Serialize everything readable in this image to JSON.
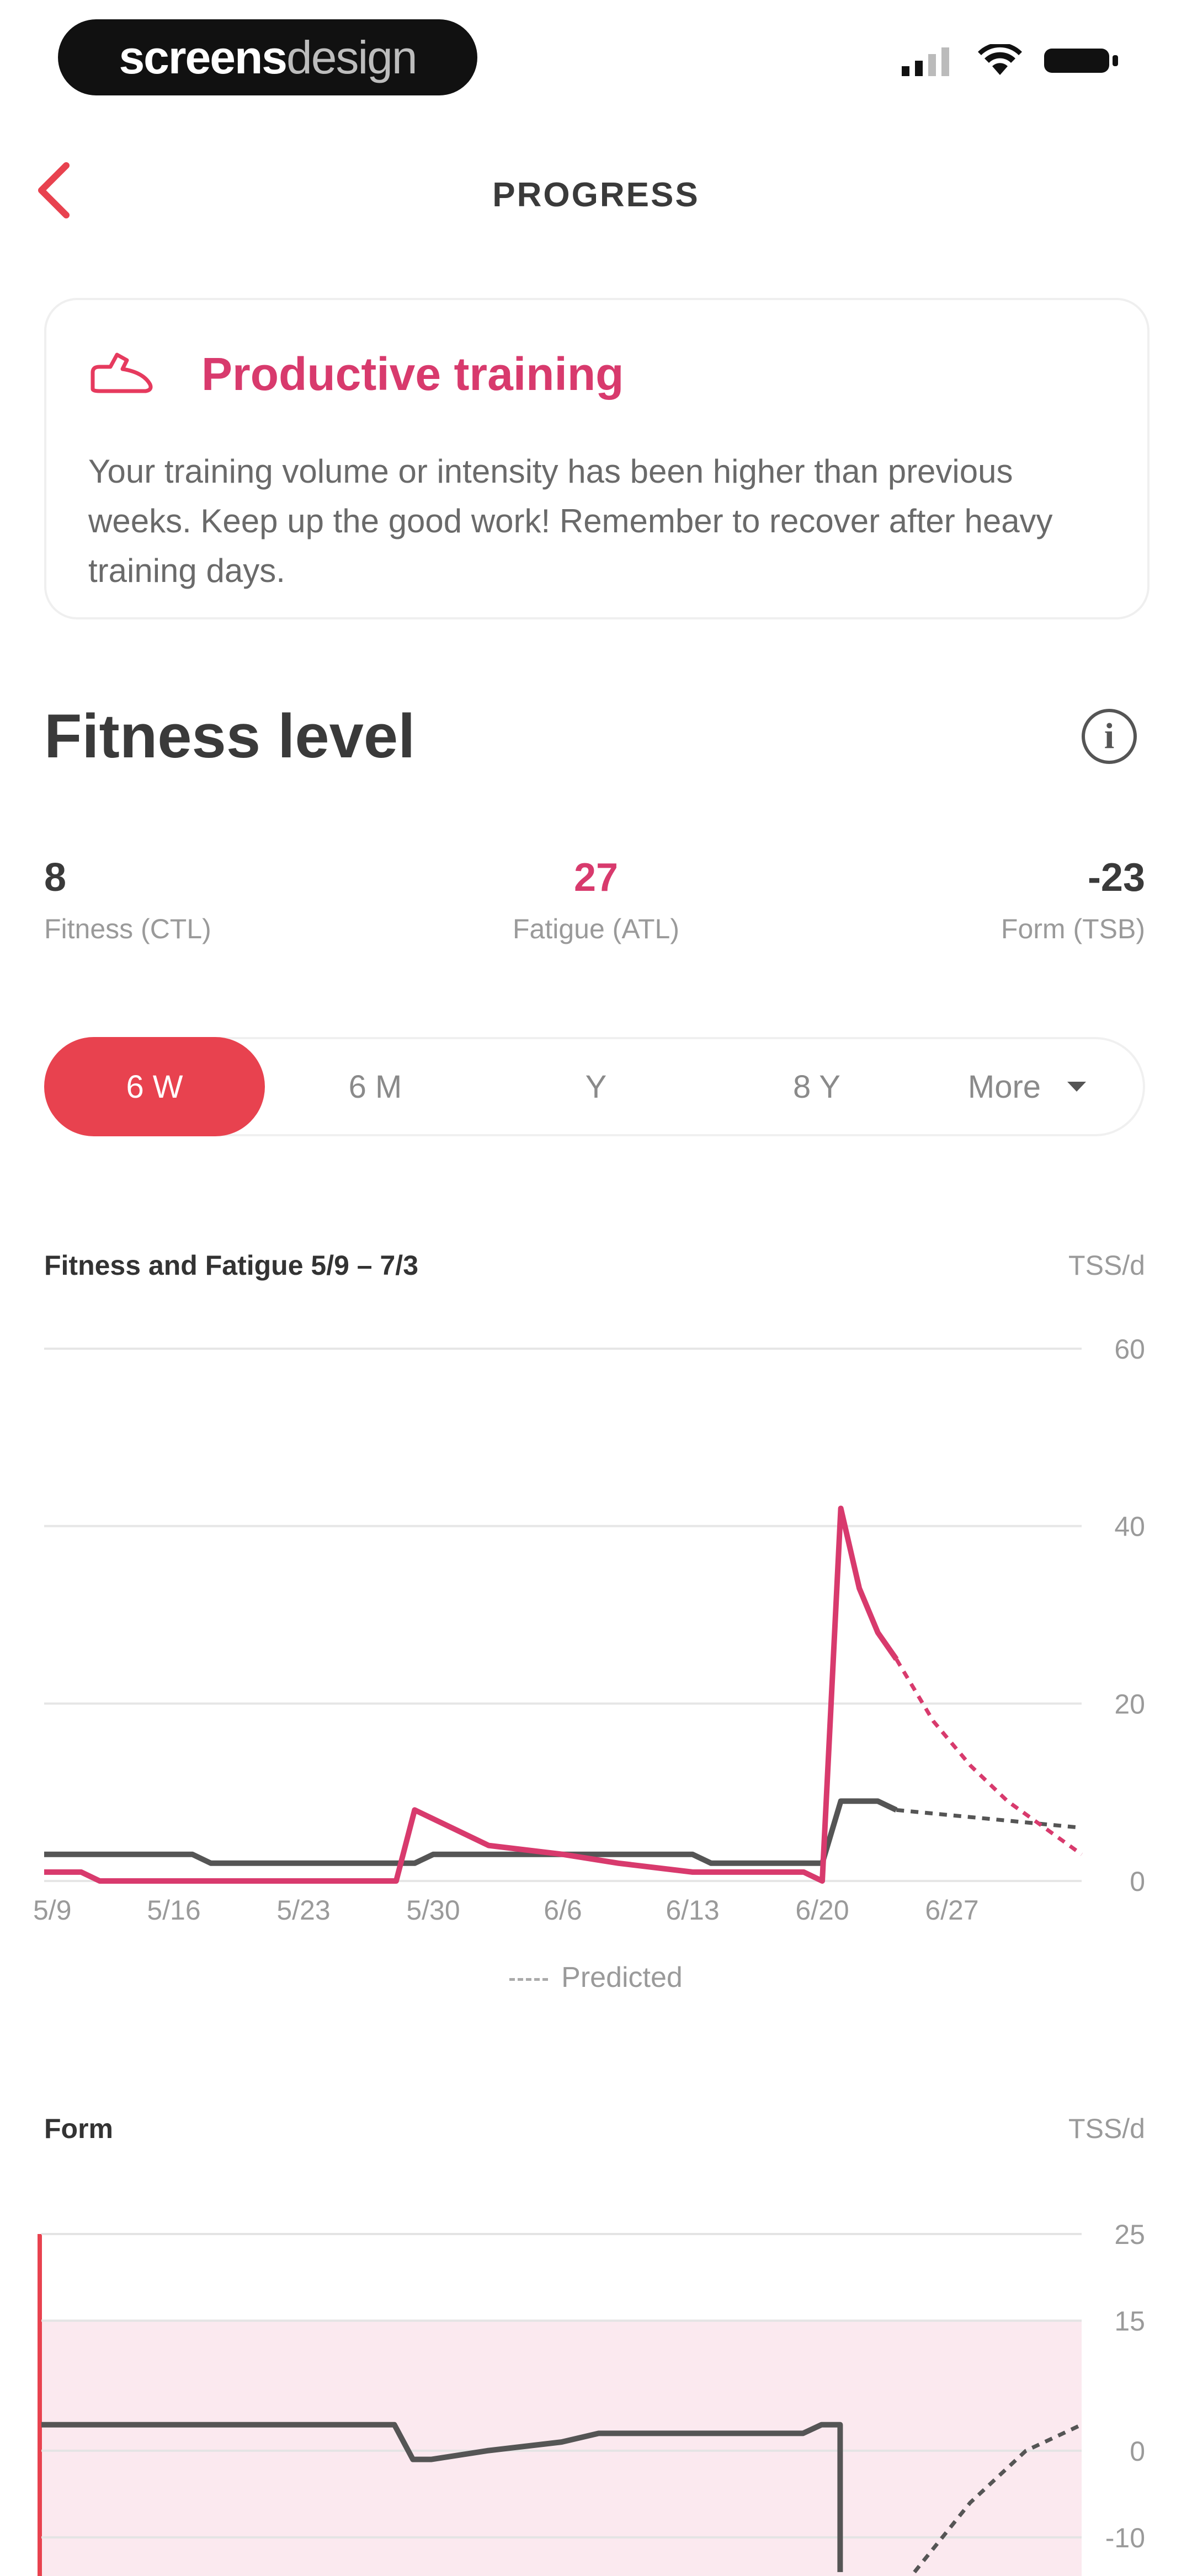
{
  "status_bar": {
    "brand_main": "screens",
    "brand_light": "design"
  },
  "header": {
    "title": "PROGRESS"
  },
  "card": {
    "title": "Productive training",
    "text": "Your training volume or intensity has been higher than previous weeks. Keep up the good work! Remember to recover after heavy training days."
  },
  "section": {
    "title": "Fitness level",
    "info_glyph": "i"
  },
  "metrics": [
    {
      "value": "8",
      "label": "Fitness (CTL)",
      "color": "#3a3a3a"
    },
    {
      "value": "27",
      "label": "Fatigue (ATL)",
      "color": "#d83a6d"
    },
    {
      "value": "-23",
      "label": "Form (TSB)",
      "color": "#3a3a3a"
    }
  ],
  "range_tabs": [
    {
      "label": "6 W",
      "active": true
    },
    {
      "label": "6 M",
      "active": false
    },
    {
      "label": "Y",
      "active": false
    },
    {
      "label": "8 Y",
      "active": false
    },
    {
      "label": "More",
      "active": false
    }
  ],
  "colors": {
    "accent": "#e8424f",
    "fatigue": "#d83a6d",
    "fitness": "#555555",
    "form_zone": "#fbe9ef"
  },
  "chart_data": [
    {
      "type": "line",
      "title": "Fitness and Fatigue 5/9 – 7/3",
      "unit": "TSS/d",
      "x_ticks": [
        "5/9",
        "5/16",
        "5/23",
        "5/30",
        "6/6",
        "6/13",
        "6/20",
        "6/27"
      ],
      "y_ticks": [
        0,
        20,
        40,
        60
      ],
      "ylim": [
        0,
        60
      ],
      "xlim": [
        0,
        56
      ],
      "legend": "Predicted",
      "series": [
        {
          "color": "#555555",
          "points": [
            [
              0,
              3
            ],
            [
              8,
              3
            ],
            [
              9,
              2
            ],
            [
              20,
              2
            ],
            [
              21,
              3
            ],
            [
              35,
              3
            ],
            [
              36,
              2
            ],
            [
              42,
              2
            ],
            [
              43,
              9
            ],
            [
              45,
              9
            ],
            [
              46,
              8
            ]
          ],
          "predicted": [
            [
              46,
              8
            ],
            [
              56,
              6
            ]
          ]
        },
        {
          "color": "#d83a6d",
          "points": [
            [
              0,
              1
            ],
            [
              1,
              1
            ],
            [
              2,
              1
            ],
            [
              3,
              0
            ],
            [
              19,
              0
            ],
            [
              20,
              8
            ],
            [
              22,
              6
            ],
            [
              24,
              4
            ],
            [
              28,
              3
            ],
            [
              31,
              2
            ],
            [
              35,
              1
            ],
            [
              41,
              1
            ],
            [
              42,
              0
            ],
            [
              43,
              42
            ],
            [
              44,
              33
            ],
            [
              45,
              28
            ],
            [
              46,
              25
            ]
          ],
          "predicted": [
            [
              46,
              25
            ],
            [
              48,
              18
            ],
            [
              50,
              13
            ],
            [
              52,
              9
            ],
            [
              54,
              6
            ],
            [
              56,
              3
            ]
          ]
        }
      ]
    },
    {
      "type": "line",
      "title": "Form",
      "unit": "TSS/d",
      "y_ticks": [
        25,
        15,
        0,
        -10
      ],
      "ylim": [
        -14,
        25
      ],
      "xlim": [
        0,
        56
      ],
      "zone": [
        -10,
        15
      ],
      "series": [
        {
          "color": "#555555",
          "points": [
            [
              0,
              3
            ],
            [
              19,
              3
            ],
            [
              20,
              -1
            ],
            [
              21,
              -1
            ],
            [
              24,
              0
            ],
            [
              28,
              1
            ],
            [
              30,
              2
            ],
            [
              35,
              2
            ],
            [
              41,
              2
            ],
            [
              42,
              3
            ],
            [
              43,
              3
            ],
            [
              43,
              -14
            ]
          ],
          "predicted": [
            [
              47,
              -14
            ],
            [
              50,
              -6
            ],
            [
              53,
              0
            ],
            [
              56,
              3
            ]
          ]
        }
      ]
    }
  ]
}
